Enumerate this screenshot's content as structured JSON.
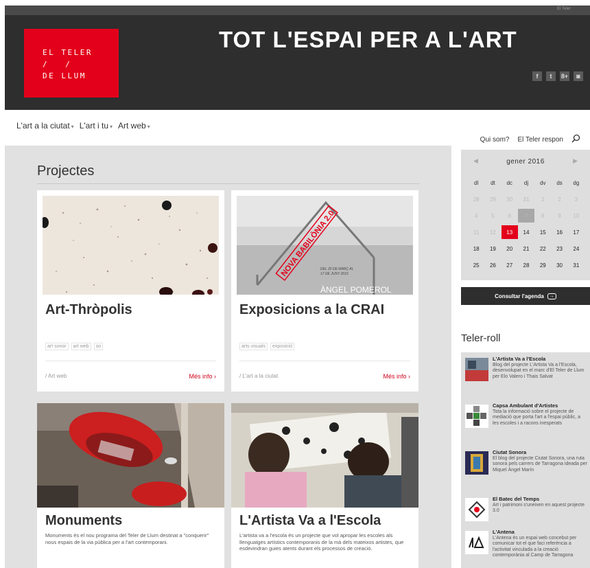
{
  "header": {
    "top_text": "El Teler",
    "logo_lines": [
      "EL TELER",
      "/ /",
      "DE LLUM"
    ],
    "tagline": "TOT L'ESPAI PER A L'ART",
    "social": [
      "f",
      "t",
      "8+",
      "◙"
    ]
  },
  "nav": {
    "items": [
      "L'art a la ciutat",
      "L'art i tu",
      "Art web"
    ],
    "caret": "▾",
    "sub": [
      "Qui som?",
      "El Teler respon"
    ]
  },
  "projects": {
    "title": "Projectes",
    "more_label": "Més info",
    "cards": [
      {
        "title": "Art-Thròpolis",
        "tags": [
          "art sonor",
          "art web",
          "so"
        ],
        "category": "Art web"
      },
      {
        "title": "Exposicions a la CRAI",
        "tags": [
          "arts visuals",
          "exposició"
        ],
        "category": "L'art a la ciutat",
        "image_text": [
          "NOVA BABILÒNIA 2.0",
          "DEL 20 DE MARÇ AL",
          "17 DE JUNY 2015",
          "ÀNGEL POMEROL"
        ]
      },
      {
        "title": "Monuments",
        "desc": "Monuments és el nou programa del Teler de Llum destinat a \"conquerir\" nous espais de la via pública per a l'art contemporani."
      },
      {
        "title": "L'Artista Va a l'Escola",
        "desc": "L'artista va a l'escola és un projecte que vol apropar les escoles als llenguatges artístics contemporanis de la mà dels mateixos artistes, que esdevindran guies atents durant els processos de creació."
      }
    ]
  },
  "calendar": {
    "month": "gener 2016",
    "prev": "◀",
    "next": "▶",
    "days": [
      "dl",
      "dt",
      "dc",
      "dj",
      "dv",
      "ds",
      "dg"
    ],
    "weeks": [
      [
        "28",
        "29",
        "30",
        "31",
        "1",
        "2",
        "3"
      ],
      [
        "4",
        "5",
        "6",
        "7",
        "8",
        "9",
        "10"
      ],
      [
        "11",
        "12",
        "13",
        "14",
        "15",
        "16",
        "17"
      ],
      [
        "18",
        "19",
        "20",
        "21",
        "22",
        "23",
        "24"
      ],
      [
        "25",
        "26",
        "27",
        "28",
        "29",
        "30",
        "31"
      ]
    ],
    "today": "13",
    "agenda_label": "Consultar l'agenda",
    "agenda_arrow": "→",
    "accent": "#e3001b"
  },
  "roll": {
    "title": "Teler-roll",
    "entries": [
      {
        "title": "L'Artista Va a l'Escola",
        "text": "Blog del projecte L'Artista Va a l'Escola, desenvolupat en el marc d'El Teler de Llum per Elo Valero i Thais Salvat"
      },
      {
        "title": "Capsa Ambulant d'Artistes",
        "text": "Tota la informació sobre el projecte de mediació que porta l'art a l'espai públic, a les escoles i a racons inesperats"
      },
      {
        "title": "Ciutat Sonora",
        "text": "El blog del projecte Ciutat Sonora, una ruta sonora pels carrers de Tarragona ideada per Miquel Àngel Marín"
      },
      {
        "title": "El Batec del Temps",
        "text": "Art i patrimoni s'uneixen en aquest projecte 3.0"
      },
      {
        "title": "L'Antena",
        "text": "L'Antena és un espai web concebut per comunicar tot el que faci referència a l'activitat vinculada a la creació contemporània al Camp de Tarragona"
      }
    ]
  }
}
